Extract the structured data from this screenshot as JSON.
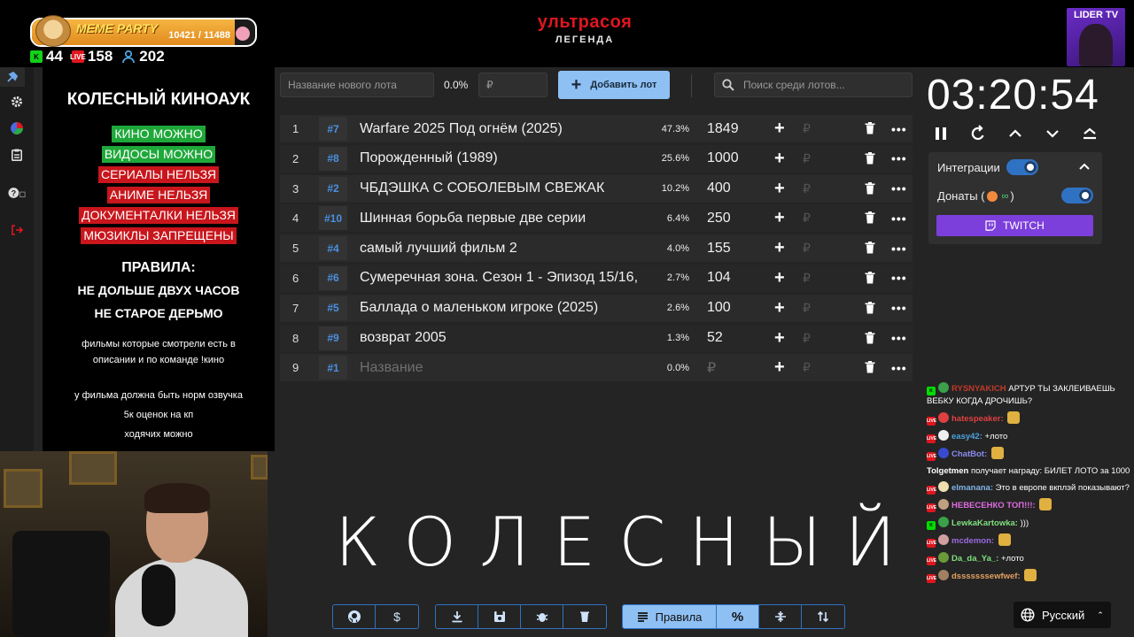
{
  "header": {
    "meme_party": {
      "label": "MEME PARTY",
      "current": "10421",
      "max": "11488",
      "count_text": "10421 / 11488",
      "progress": 0.907
    },
    "stats": {
      "kick": "44",
      "live": "158",
      "viewers": "202"
    },
    "brand_title": "ультрасоя",
    "brand_sub": "ЛЕГЕНДА",
    "lider_tv": "LIDER TV"
  },
  "rules": {
    "title": "КОЛЕСНЫЙ КИНОАУК",
    "list": [
      {
        "text": "КИНО МОЖНО",
        "color": "#1fa83a"
      },
      {
        "text": "ВИДОСЫ МОЖНО",
        "color": "#1fa83a"
      },
      {
        "text": "СЕРИАЛЫ НЕЛЬЗЯ",
        "color": "#c8161c"
      },
      {
        "text": "АНИМЕ НЕЛЬЗЯ",
        "color": "#c8161c"
      },
      {
        "text": "ДОКУМЕНТАЛКИ НЕЛЬЗЯ",
        "color": "#c8161c"
      },
      {
        "text": "МЮЗИКЛЫ ЗАПРЕЩЕНЫ",
        "color": "#c8161c"
      }
    ],
    "head": "ПРАВИЛА:",
    "sub1": "НЕ ДОЛЬШЕ ДВУХ ЧАСОВ",
    "sub2": "НЕ СТАРОЕ ДЕРЬМО",
    "note1a": "фильмы которые смотрели есть в",
    "note1b": "описании и по команде !кино",
    "note2a": "у фильма должна быть норм озвучка",
    "note2b": "5к оценок на кп",
    "note2c": "ходячих можно"
  },
  "toolbar": {
    "new_lot_placeholder": "Название нового лота",
    "percent": "0.0%",
    "rub_placeholder": "₽",
    "add_label": "Добавить лот",
    "search_placeholder": "Поиск среди лотов..."
  },
  "lots": [
    {
      "idx": "1",
      "id": "#7",
      "name": "Warfare 2025 Под огнём (2025)",
      "pct": "47.3%",
      "value": "1849"
    },
    {
      "idx": "2",
      "id": "#8",
      "name": "Порожденный (1989)",
      "pct": "25.6%",
      "value": "1000"
    },
    {
      "idx": "3",
      "id": "#2",
      "name": "ЧБДЭШКА С СОБОЛЕВЫМ СВЕЖАК",
      "pct": "10.2%",
      "value": "400"
    },
    {
      "idx": "4",
      "id": "#10",
      "name": " Шинная борьба первые две серии",
      "pct": "6.4%",
      "value": "250"
    },
    {
      "idx": "5",
      "id": "#4",
      "name": "самый лучший фильм 2",
      "pct": "4.0%",
      "value": "155"
    },
    {
      "idx": "6",
      "id": "#6",
      "name": "Сумеречная зона. Сезон 1 - Эпизод 15/16,",
      "pct": "2.7%",
      "value": "104"
    },
    {
      "idx": "7",
      "id": "#5",
      "name": "Баллада о маленьком игроке (2025)",
      "pct": "2.6%",
      "value": "100"
    },
    {
      "idx": "8",
      "id": "#9",
      "name": "возврат 2005",
      "pct": "1.3%",
      "value": "52"
    },
    {
      "idx": "9",
      "id": "#1",
      "name": "Название",
      "pct": "0.0%",
      "value": "₽",
      "placeholder": true
    }
  ],
  "row_plus": "+",
  "row_rub": "₽",
  "row_more": "•••",
  "big_word": "КОЛЕСНЫЙ",
  "bottom": {
    "rules_label": "Правила",
    "percent_symbol": "%",
    "dollar": "$"
  },
  "timer": "03:20:54",
  "integrations": {
    "label": "Интеграции",
    "donations": "Донаты (",
    "donations_end": ")",
    "twitch": "TWITCH"
  },
  "chat": [
    {
      "platform": "k",
      "nick": "RYSNYAKICH",
      "nick_color": "#c0392b",
      "text": "АРТУР ТЫ ЗАКЛЕИВАЕШЬ ВЕБКУ КОГДА ДРОЧИШЬ?"
    },
    {
      "platform": "l",
      "nick": "hatespeaker:",
      "nick_color": "#e04040",
      "text": ""
    },
    {
      "platform": "l",
      "nick": "easy42:",
      "nick_color": "#4aa3e0",
      "text": "+лото"
    },
    {
      "platform": "l",
      "nick": "ChatBot:",
      "nick_color": "#8a8cf0",
      "text": ""
    },
    {
      "platform": "",
      "nick": "Tolgetmen",
      "nick_color": "#ffffff",
      "text": "получает награду: БИЛЕТ ЛОТО за 1000"
    },
    {
      "platform": "l",
      "nick": "elmanana:",
      "nick_color": "#7fb3e8",
      "text": "Это в европе вкплэй показывают?"
    },
    {
      "platform": "l",
      "nick": "НЕВЕСЕНКО ТОП!!!:",
      "nick_color": "#e06be0",
      "text": ""
    },
    {
      "platform": "k",
      "nick": "LewkaKartowka:",
      "nick_color": "#7fe07f",
      "text": ")))"
    },
    {
      "platform": "l",
      "nick": "mcdemon:",
      "nick_color": "#9a6be0",
      "text": ""
    },
    {
      "platform": "l",
      "nick": "Da_da_Ya_:",
      "nick_color": "#7fe07f",
      "text": "+лото"
    },
    {
      "platform": "l",
      "nick": "dsssssssewfwef:",
      "nick_color": "#e0a060",
      "text": ""
    }
  ],
  "language": "Русский"
}
